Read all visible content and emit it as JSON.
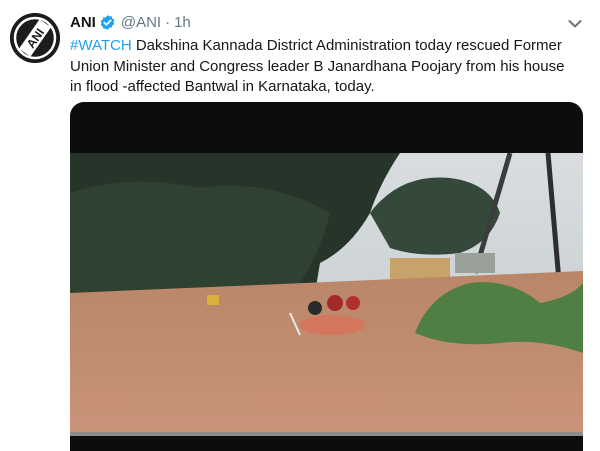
{
  "tweet": {
    "author_name": "ANI",
    "handle": "@ANI",
    "separator": "·",
    "time": "1h",
    "hashtag": "#WATCH",
    "body": " Dakshina Kannada District Administration today rescued Former Union Minister and Congress leader B Janardhana Poojary from his house in flood -affected Bantwal in Karnataka, today."
  },
  "icons": {
    "avatar": "ani-logo-icon",
    "verified": "verified-badge-icon",
    "menu": "chevron-down-icon"
  },
  "avatar_logo_text": "ANI",
  "colors": {
    "link": "#1da1f2",
    "secondary_text": "#657786",
    "flood_water": "#c08a70"
  }
}
